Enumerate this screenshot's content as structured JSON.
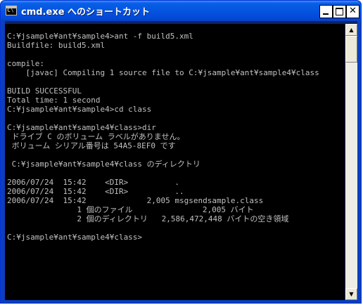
{
  "window": {
    "title": "cmd.exe へのショートカット",
    "icon": "C\\"
  },
  "controls": {
    "minimize_icon": "minimize-icon",
    "maximize_icon": "maximize-icon",
    "close_glyph": "✕"
  },
  "scrollbar": {
    "up_arrow": "▲",
    "down_arrow": "▼"
  },
  "console": {
    "lines": [
      "C:¥jsample¥ant¥sample4>ant -f build5.xml",
      "Buildfile: build5.xml",
      "",
      "compile:",
      "    [javac] Compiling 1 source file to C:¥jsample¥ant¥sample4¥class",
      "",
      "BUILD SUCCESSFUL",
      "Total time: 1 second",
      "C:¥jsample¥ant¥sample4>cd class",
      "",
      "C:¥jsample¥ant¥sample4¥class>dir",
      " ドライブ C のボリューム ラベルがありません。",
      " ボリューム シリアル番号は 54A5-8EF0 です",
      "",
      " C:¥jsample¥ant¥sample4¥class のディレクトリ",
      "",
      "2006/07/24  15:42    <DIR>          .",
      "2006/07/24  15:42    <DIR>          ..",
      "2006/07/24  15:42             2,005 msgsendsample.class",
      "               1 個のファイル               2,005 バイト",
      "               2 個のディレクトリ   2,586,472,448 バイトの空き領域",
      "",
      "C:¥jsample¥ant¥sample4¥class>"
    ]
  }
}
